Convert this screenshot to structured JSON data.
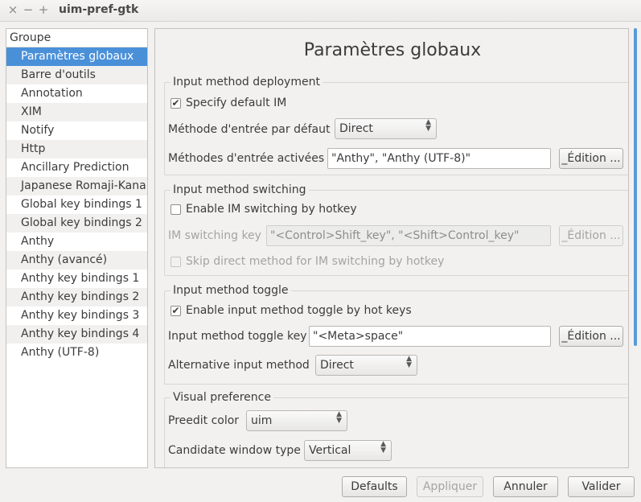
{
  "window": {
    "title": "uim-pref-gtk",
    "close_glyph": "×",
    "minimize_glyph": "−",
    "maximize_glyph": "+"
  },
  "sidebar": {
    "header": "Groupe",
    "items": [
      "Paramètres globaux",
      "Barre d'outils",
      "Annotation",
      "XIM",
      "Notify",
      "Http",
      "Ancillary Prediction",
      "Japanese Romaji-Kana",
      "Global key bindings 1",
      "Global key bindings 2",
      "Anthy",
      "Anthy (avancé)",
      "Anthy key bindings 1",
      "Anthy key bindings 2",
      "Anthy key bindings 3",
      "Anthy key bindings 4",
      "Anthy (UTF-8)"
    ],
    "selected_index": 0
  },
  "main": {
    "title": "Paramètres globaux",
    "deployment": {
      "title": "Input method deployment",
      "specify_default_label": "Specify default IM",
      "specify_default_checked": true,
      "default_label": "Méthode d'entrée par défaut",
      "default_value": "Direct",
      "enabled_label": "Méthodes d'entrée activées",
      "enabled_value": "\"Anthy\", \"Anthy (UTF-8)\"",
      "edit_label": "_Édition ..."
    },
    "switching": {
      "title": "Input method switching",
      "enable_label": "Enable IM switching by hotkey",
      "enable_checked": false,
      "key_label": "IM switching key",
      "key_value": "\"<Control>Shift_key\", \"<Shift>Control_key\"",
      "edit_label": "_Édition ...",
      "skip_label": "Skip direct method for IM switching by hotkey",
      "skip_checked": false
    },
    "toggle": {
      "title": "Input method toggle",
      "enable_label": "Enable input method toggle by hot keys",
      "enable_checked": true,
      "key_label": "Input method toggle key",
      "key_value": "\"<Meta>space\"",
      "edit_label": "_Édition ...",
      "alt_label": "Alternative input method",
      "alt_value": "Direct"
    },
    "visual": {
      "title": "Visual preference",
      "preedit_label": "Preedit color",
      "preedit_value": "uim",
      "candidate_label": "Candidate window type",
      "candidate_value": "Vertical"
    }
  },
  "footer": {
    "defaults": "Defaults",
    "apply": "Appliquer",
    "cancel": "Annuler",
    "ok": "Valider"
  },
  "colors": {
    "selection": "#4a90d9",
    "scrollbar": "#5a9bd8"
  }
}
